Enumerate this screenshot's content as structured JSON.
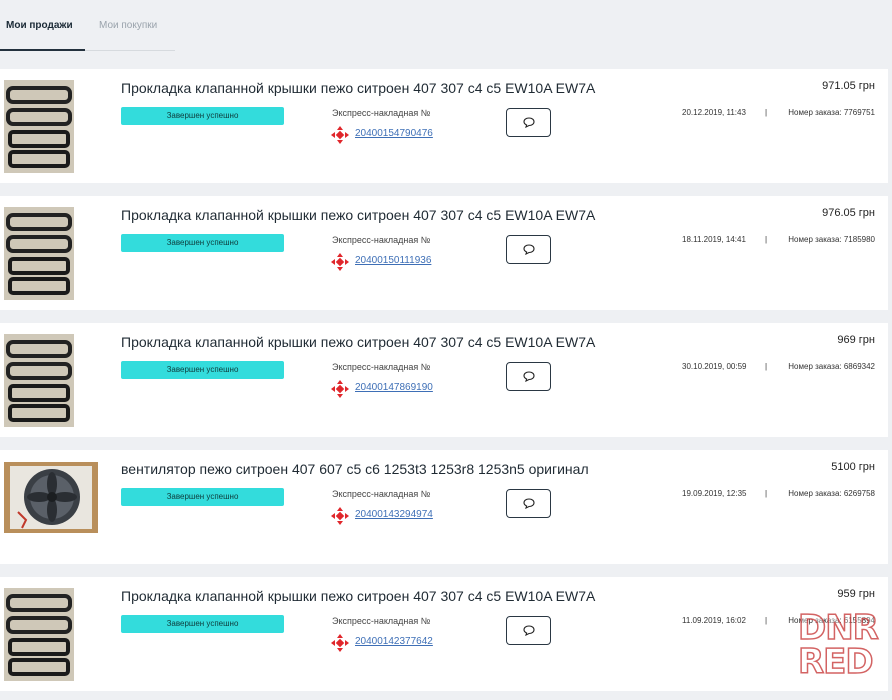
{
  "tabs": {
    "active": "Мои продажи",
    "inactive": "Мои покупки"
  },
  "colors": {
    "status_bg": "#33dcdc",
    "link": "#3e6fb6",
    "nova_poshta_red": "#e0262b"
  },
  "orders": [
    {
      "title": "Прокладка клапанной крышки пежо ситроен 407 307 с4 с5 EW10A EW7A",
      "price": "971.05 грн",
      "status": "Завершен успешно",
      "waybill_label": "Экспресс-накладная №",
      "waybill_number": "20400154790476",
      "date": "20.12.2019, 11:43",
      "separator": "|",
      "order_number": "Номер заказа: 7769751",
      "thumb_icon": "gasket-image"
    },
    {
      "title": "Прокладка клапанной крышки пежо ситроен 407 307 с4 с5 EW10A EW7A",
      "price": "976.05 грн",
      "status": "Завершен успешно",
      "waybill_label": "Экспресс-накладная №",
      "waybill_number": "20400150111936",
      "date": "18.11.2019, 14:41",
      "separator": "|",
      "order_number": "Номер заказа: 7185980",
      "thumb_icon": "gasket-image"
    },
    {
      "title": "Прокладка клапанной крышки пежо ситроен 407 307 с4 с5 EW10A EW7A",
      "price": "969 грн",
      "status": "Завершен успешно",
      "waybill_label": "Экспресс-накладная №",
      "waybill_number": "20400147869190",
      "date": "30.10.2019, 00:59",
      "separator": "|",
      "order_number": "Номер заказа: 6869342",
      "thumb_icon": "gasket-image"
    },
    {
      "title": "вентилятор пежо ситроен 407 607 с5 с6 1253t3 1253r8 1253n5 оригинал",
      "price": "5100 грн",
      "status": "Завершен успешно",
      "waybill_label": "Экспресс-накладная №",
      "waybill_number": "20400143294974",
      "date": "19.09.2019, 12:35",
      "separator": "|",
      "order_number": "Номер заказа: 6269758",
      "thumb_icon": "fan-image"
    },
    {
      "title": "Прокладка клапанной крышки пежо ситроен 407 307 с4 с5 EW10A EW7A",
      "price": "959 грн",
      "status": "Завершен успешно",
      "waybill_label": "Экспресс-накладная №",
      "waybill_number": "20400142377642",
      "date": "11.09.2019, 16:02",
      "separator": "|",
      "order_number": "Номер заказа: 6155894",
      "thumb_icon": "gasket-image"
    }
  ],
  "watermark": [
    "DNR",
    "RED"
  ]
}
